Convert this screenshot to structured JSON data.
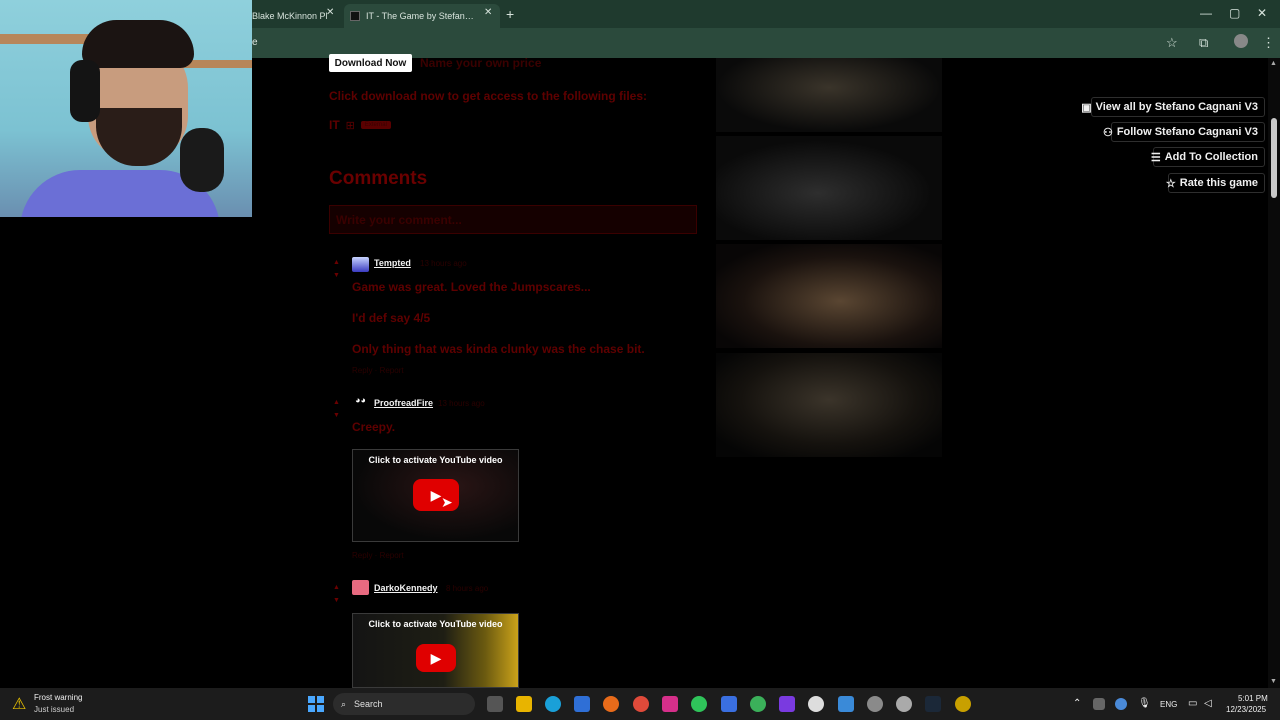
{
  "browser": {
    "tab_inactive_title": "Blake McKinnon Pl",
    "tab_active_title": "IT - The Game by Stefano Cagnani V3",
    "close_glyph": "✕",
    "new_tab_glyph": "+",
    "url_fragment": "e",
    "win_min": "—",
    "win_max": "▢",
    "win_close": "✕",
    "star_glyph": "☆",
    "ext_glyph": "⧉",
    "menu_glyph": "⋮"
  },
  "page": {
    "download_label": "Download Now",
    "name_price_label": "Name your own price",
    "download_info": "Click download now to get access to the following files:",
    "file_name": "IT",
    "file_os_glyph": "⊞",
    "file_badge": "External",
    "comments_heading": "Comments",
    "comment_placeholder": "Write your comment..."
  },
  "comments": [
    {
      "user": "Tempted",
      "time": "13 hours ago",
      "lines": [
        "Game was great. Loved the Jumpscares...",
        "I'd def say 4/5",
        "Only thing that was kinda clunky was the chase bit."
      ],
      "actions": "Reply · Report"
    },
    {
      "user": "ProofreadFire",
      "time": "13 hours ago",
      "lines": [
        "Creepy."
      ],
      "video_label": "Click to activate YouTube video",
      "actions": "Reply · Report"
    },
    {
      "user": "DarkoKennedy",
      "time": "8 hours ago",
      "video_label": "Click to activate YouTube video"
    }
  ],
  "sidebar": {
    "view_all": "View all by Stefano Cagnani V3",
    "follow": "Follow Stefano Cagnani V3",
    "add_collection": "Add To Collection",
    "rate": "Rate this game"
  },
  "taskbar": {
    "warning_title": "Frost warning",
    "warning_sub": "Just issued",
    "search_label": "Search",
    "lang": "ENG",
    "time": "5:01 PM",
    "date": "12/23/2025"
  },
  "colors": {
    "chrome_bg": "#1f3a2e",
    "accent_red": "#5e0000",
    "youtube_red": "#e00000"
  }
}
